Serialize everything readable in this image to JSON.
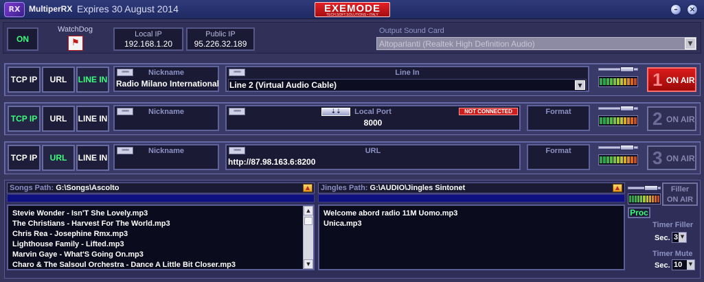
{
  "window": {
    "app_name": "MultiperRX",
    "expires": "Expires 30 August 2014",
    "brand_name": "EXEMODE",
    "brand_sub": "TECH.SOFT.SOLUTIONS • ITALY",
    "logo_text": "RX",
    "minimize_glyph": "–",
    "close_glyph": "×"
  },
  "top": {
    "on_label": "ON",
    "watchdog_label": "WatchDog",
    "local_ip_label": "Local IP",
    "local_ip": "192.168.1.20",
    "public_ip_label": "Public IP",
    "public_ip": "95.226.32.189",
    "output_card_label": "Output Sound Card",
    "output_card_value": "Altoparlanti (Realtek High Definition Audio)"
  },
  "channels": [
    {
      "number": "1",
      "tcp_label": "TCP IP",
      "url_label": "URL",
      "linein_label": "LINE IN",
      "active_source": "LINE IN",
      "nickname_label": "Nickname",
      "nickname_value": "Radio Milano International",
      "source_label": "Line In",
      "source_value": "Line 2 (Virtual Audio Cable)",
      "onair_label": "ON AIR",
      "live": true,
      "volume": 0.85
    },
    {
      "number": "2",
      "tcp_label": "TCP IP",
      "url_label": "URL",
      "linein_label": "LINE IN",
      "active_source": "TCP IP",
      "nickname_label": "Nickname",
      "nickname_value": "",
      "source_label": "Local Port",
      "source_value": "8000",
      "status_label": "NOT CONNECTED",
      "format_label": "Format",
      "onair_label": "ON AIR",
      "live": false,
      "volume": 0.85
    },
    {
      "number": "3",
      "tcp_label": "TCP IP",
      "url_label": "URL",
      "linein_label": "LINE IN",
      "active_source": "URL",
      "nickname_label": "Nickname",
      "nickname_value": "",
      "source_label": "URL",
      "source_value": "http://87.98.163.6:8200",
      "format_label": "Format",
      "onair_label": "ON AIR",
      "live": false,
      "volume": 0.85
    }
  ],
  "songs": {
    "path_label": "Songs Path:",
    "path_value": "G:\\Songs\\Ascolto",
    "items": [
      "Stevie Wonder - Isn'T She Lovely.mp3",
      "The Christians - Harvest For The World.mp3",
      "Chris Rea - Josephine Rmx.mp3",
      "Lighthouse Family - Lifted.mp3",
      "Marvin Gaye - What'S Going On.mp3",
      "Charo & The Salsoul Orchestra - Dance A Little Bit Closer.mp3"
    ]
  },
  "jingles": {
    "path_label": "Jingles Path:",
    "path_value": "G:\\AUDIO\\Jingles Sintonet",
    "items": [
      "Welcome abord radio 11M Uomo.mp3",
      "Unica.mp3"
    ]
  },
  "filler": {
    "label": "Filler",
    "onair_label": "ON AIR",
    "proc_label": "Proc",
    "timer_filler_label": "Timer Filler",
    "timer_filler_sec_label": "Sec.",
    "timer_filler_value": "3",
    "timer_mute_label": "Timer Mute",
    "timer_mute_sec_label": "Sec.",
    "timer_mute_value": "10",
    "volume": 0.85
  },
  "icons": {
    "keyboard": "keyboard-icon",
    "folder": "folder-icon",
    "swap": "swap-arrows-icon",
    "watchdog": "watchdog-icon"
  },
  "colors": {
    "active_green": "#3aff7a",
    "onair_red": "#d91b1b",
    "background": "#35355e"
  }
}
